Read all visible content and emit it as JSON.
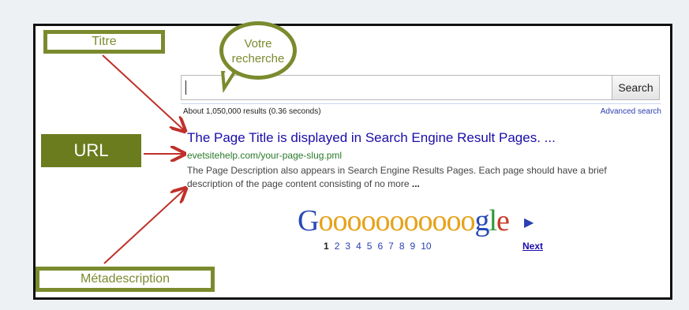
{
  "annotations": {
    "titre_label": "Titre",
    "url_label": "URL",
    "meta_label": "Métadescription",
    "bubble_label": "Votre recherche"
  },
  "search": {
    "value": "",
    "button_label": "Search",
    "stats": "About 1,050,000 results (0.36 seconds)",
    "advanced_link": "Advanced search"
  },
  "result": {
    "title": "The Page Title is displayed in Search Engine Result Pages. ...",
    "url": "evetsitehelp.com/your-page-slug.pml",
    "description": "The Page Description also appears in Search Engine Results Pages. Each page should have a brief description of the page content consisting of no more",
    "description_ellipsis": "..."
  },
  "pagination": {
    "logo_text": "Gooooooooooogle",
    "pages": [
      "1",
      "2",
      "3",
      "4",
      "5",
      "6",
      "7",
      "8",
      "9",
      "10"
    ],
    "current": "1",
    "next_label": "Next"
  },
  "colors": {
    "annotation_green": "#7a8b2e",
    "arrow_red": "#c0302a",
    "link_blue": "#1a0dab",
    "url_green": "#2a7a2a"
  }
}
